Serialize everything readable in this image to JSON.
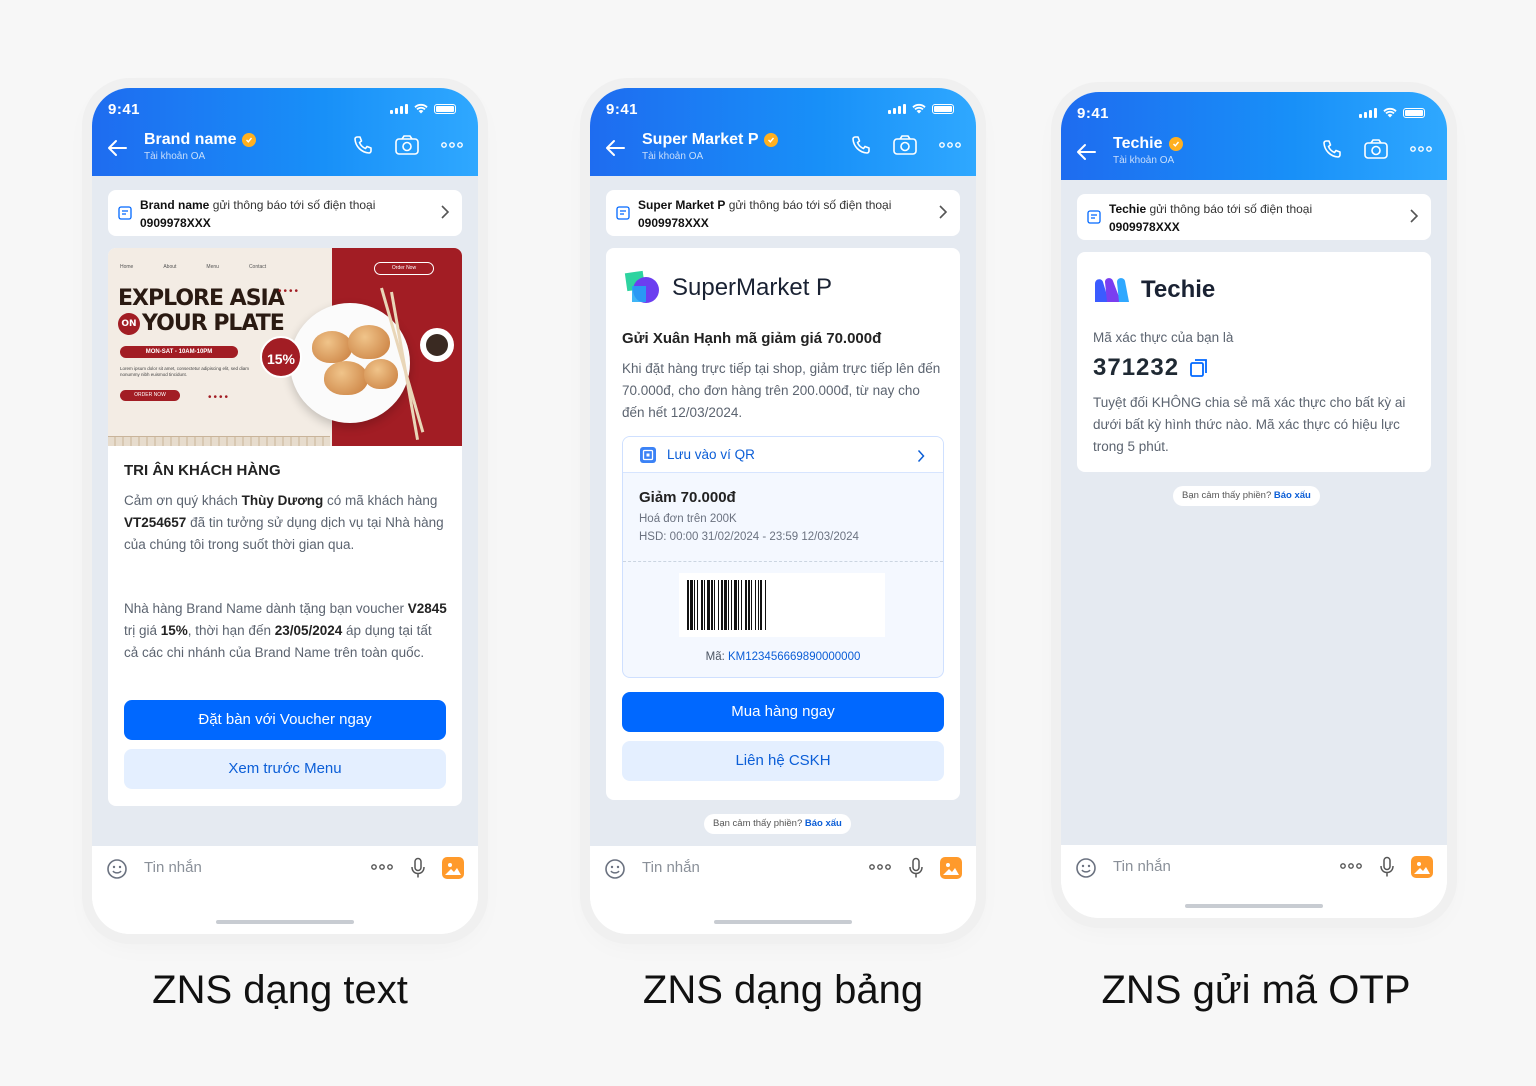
{
  "status_time": "9:41",
  "input_placeholder": "Tin nhắn",
  "report": {
    "text": "Bạn cảm thấy phiền?",
    "link": "Báo xấu"
  },
  "notice_suffix": "gửi thông báo tới số điện thoại",
  "notice_phone": "0909978XXX",
  "oa_subtitle": "Tài khoản OA",
  "phone1": {
    "brand": "Brand name",
    "banner": {
      "nav": [
        "Home",
        "About",
        "Menu",
        "Contact"
      ],
      "order_pill": "Order Now",
      "headline_line1": "EXPLORE ASIA",
      "on_badge": "ON",
      "headline_line2": "YOUR PLATE",
      "hours": "MON-SAT - 10AM-10PM",
      "lorem": "Lorem ipsum dolor sit amet, consectetur adipiscing elit, sed diam nonummy nibh euismod tincidunt.",
      "order_btn": "ORDER NOW",
      "discount": "15%"
    },
    "title": "TRI ÂN KHÁCH HÀNG",
    "p1_a": "Cảm ơn quý khách ",
    "p1_name": "Thùy Dương",
    "p1_b": " có mã khách hàng ",
    "p1_code": "VT254657",
    "p1_c": " đã tin tưởng sử dụng dịch vụ tại Nhà hàng của chúng tôi trong suốt thời gian qua.",
    "p2_a": "Nhà hàng Brand Name dành tặng bạn voucher ",
    "p2_voucher": "V2845",
    "p2_b": " trị giá ",
    "p2_value": "15%",
    "p2_c": ", thời hạn đến ",
    "p2_date": "23/05/2024",
    "p2_d": " áp dụng tại tất cả các chi nhánh của Brand Name trên toàn quốc.",
    "btn_primary": "Đặt bàn với Voucher ngay",
    "btn_secondary": "Xem trước Menu",
    "caption": "ZNS dạng text"
  },
  "phone2": {
    "brand": "Super Market P",
    "logo_text": "SuperMarket P",
    "title": "Gửi Xuân Hạnh mã giảm giá 70.000đ",
    "body": "Khi đặt hàng trực tiếp tại shop, giảm trực tiếp lên đến 70.000đ, cho đơn hàng trên 200.000đ, từ nay cho đến hết 12/03/2024.",
    "qr_label": "Lưu vào ví QR",
    "voucher_title": "Giảm 70.000đ",
    "voucher_cond": "Hoá đơn trên 200K",
    "voucher_exp": "HSD: 00:00 31/02/2024 - 23:59 12/03/2024",
    "code_label": "Mã:",
    "code_value": "KM123456669890000000",
    "btn_primary": "Mua hàng ngay",
    "btn_secondary": "Liên hệ CSKH",
    "caption": "ZNS dạng bảng"
  },
  "phone3": {
    "brand": "Techie",
    "logo_text": "Techie",
    "label": "Mã xác thực của bạn là",
    "otp": "371232",
    "body": "Tuyệt đối KHÔNG chia sẻ mã xác thực cho bất kỳ ai dưới bất kỳ hình thức nào. Mã xác thực có hiệu lực trong 5 phút.",
    "caption": "ZNS gửi mã OTP"
  },
  "colors": {
    "accent": "#0068ff",
    "header": "#1e6cf0",
    "banner_red": "#a21d24",
    "verified": "#ffb020"
  },
  "icons": [
    "back-arrow-icon",
    "verified-icon",
    "phone-call-icon",
    "video-camera-icon",
    "more-icon",
    "notice-icon",
    "chevron-right-icon",
    "emoji-icon",
    "microphone-icon",
    "image-icon",
    "wallet-qr-icon",
    "copy-icon"
  ]
}
